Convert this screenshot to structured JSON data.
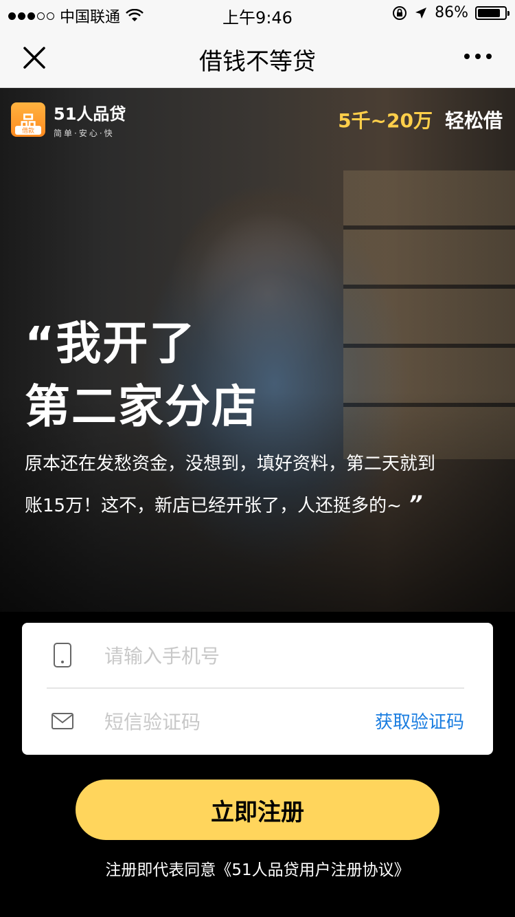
{
  "status_bar": {
    "carrier": "中国联通",
    "time": "上午9:46",
    "battery_percent": "86%",
    "battery_level": 0.86,
    "signal_dots_filled": 3,
    "signal_dots_total": 5
  },
  "nav": {
    "title": "借钱不等贷",
    "close_icon": "close-icon",
    "more_icon": "more-icon"
  },
  "hero": {
    "brand": {
      "badge_char": "品",
      "badge_sub": "借款",
      "name": "51人品贷",
      "slogan": "简单·安心·快"
    },
    "promo": {
      "amount": "5千~20万",
      "text": "轻松借"
    },
    "headline_line1": "“我开了",
    "headline_line2": "第二家分店",
    "quote_body": "原本还在发愁资金，没想到，填好资料，第二天就到账15万！这不，新店已经开张了，人还挺多的~",
    "close_quote": "”"
  },
  "form": {
    "phone_placeholder": "请输入手机号",
    "code_placeholder": "短信验证码",
    "get_code_label": "获取验证码",
    "phone_icon": "phone-icon",
    "mail_icon": "mail-icon"
  },
  "register_label": "立即注册",
  "agreement": "注册即代表同意《51人品贷用户注册协议》",
  "colors": {
    "accent": "#ffd55c",
    "promo": "#ffcf4a",
    "link": "#1a7de0",
    "brand": "#ff8a1f"
  }
}
